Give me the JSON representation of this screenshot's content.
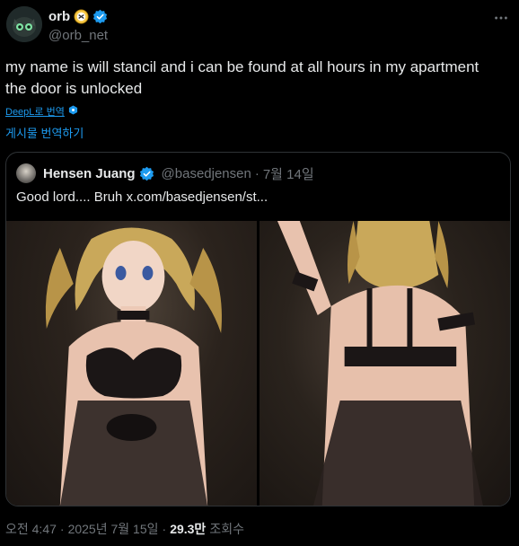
{
  "author": {
    "name": "orb",
    "handle": "@orb_net"
  },
  "tweet": {
    "text_line1": "my name is will stancil and i can be found at all hours in my apartment",
    "text_line2": "the door is unlocked",
    "translate_label": "DeepL로 번역",
    "post_translate_label": "게시물 번역하기"
  },
  "quote": {
    "name": "Hensen Juang",
    "handle": "@basedjensen",
    "dot": "·",
    "date": "7월 14일",
    "text": "Good lord.... Bruh  x.com/basedjensen/st..."
  },
  "footer": {
    "time": "오전 4:47",
    "sep1": "·",
    "date": "2025년 7월 15일",
    "sep2": "·",
    "views": "29.3만",
    "views_label": "조회수"
  },
  "colors": {
    "accent": "#1d9bf0",
    "muted": "#71767b",
    "text": "#e7e9ea",
    "border": "#2f3336"
  },
  "icons": {
    "verified": "verified-badge-icon",
    "affiliate": "affiliate-badge-icon",
    "more": "more-dots-icon",
    "deepl": "deepl-icon"
  }
}
